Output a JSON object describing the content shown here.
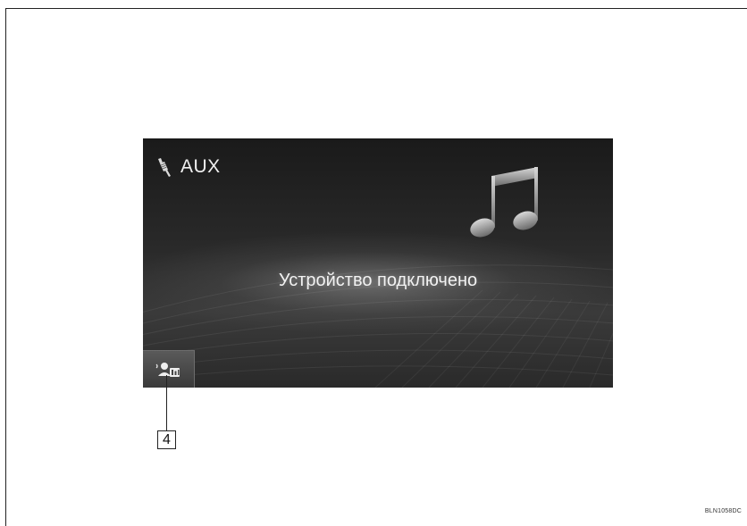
{
  "screen": {
    "source": {
      "label": "AUX",
      "icon": "aux-plug-icon"
    },
    "decoration_icon": "music-note-icon",
    "status_text": "Устройство подключено",
    "settings_button": {
      "icon": "sound-settings-icon"
    }
  },
  "callout": {
    "number": "4"
  },
  "image_code": "BLN1058DC"
}
